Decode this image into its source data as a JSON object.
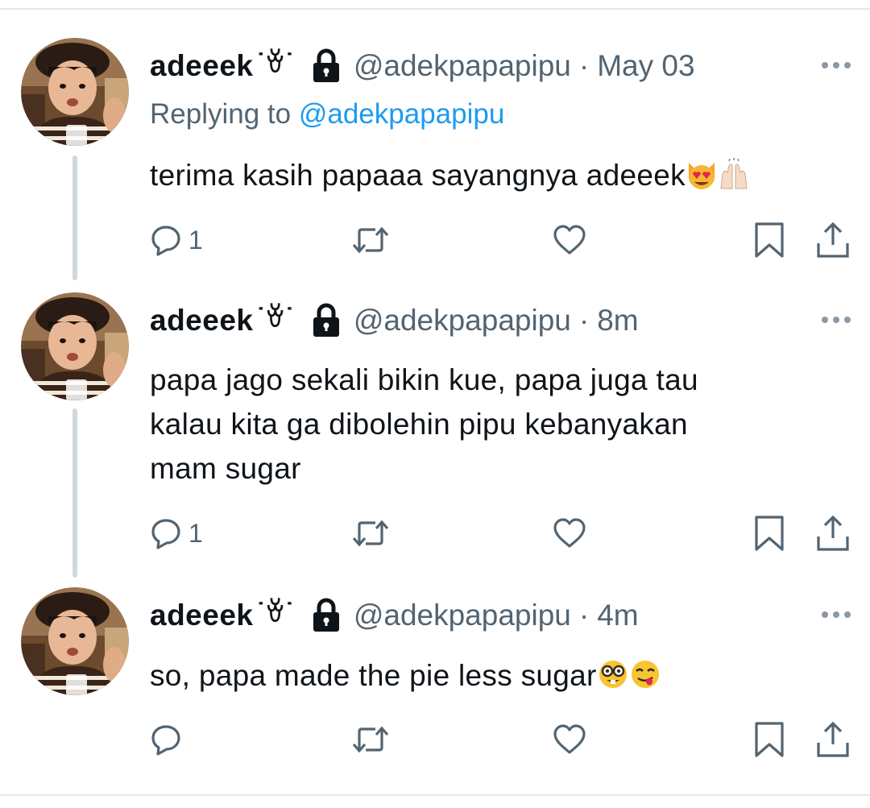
{
  "colors": {
    "text": "#0f1419",
    "muted": "#536471",
    "accent": "#1d9bf0",
    "thread_line": "#cfd9de",
    "icon_stroke": "#536471"
  },
  "tweets": [
    {
      "name": "adeeek",
      "kaomoji": "˙ꈊ˙",
      "handle": "@adekpapapipu",
      "separator": "·",
      "time": "May 03",
      "replying_prefix": "Replying to",
      "replying_handle": "@adekpapapipu",
      "text": "terima kasih papaaa sayangnya adeeek",
      "emojis": [
        "heart-eyes-cat-emoji",
        "raising-hands-emoji"
      ],
      "reply_count": "1",
      "icons": [
        "reply-icon",
        "retweet-icon",
        "like-icon",
        "bookmark-icon",
        "share-icon",
        "more-icon",
        "lock-icon"
      ]
    },
    {
      "name": "adeeek",
      "kaomoji": "˙ꈊ˙",
      "handle": "@adekpapapipu",
      "separator": "·",
      "time": "8m",
      "text_lines": [
        "papa jago sekali bikin kue, papa juga tau",
        "kalau kita ga dibolehin pipu kebanyakan",
        "mam sugar"
      ],
      "reply_count": "1"
    },
    {
      "name": "adeeek",
      "kaomoji": "˙ꈊ˙",
      "handle": "@adekpapapipu",
      "separator": "·",
      "time": "4m",
      "text": "so, papa made the pie less sugar",
      "emojis": [
        "nerd-face-emoji",
        "savoring-food-emoji"
      ],
      "reply_count": ""
    }
  ]
}
